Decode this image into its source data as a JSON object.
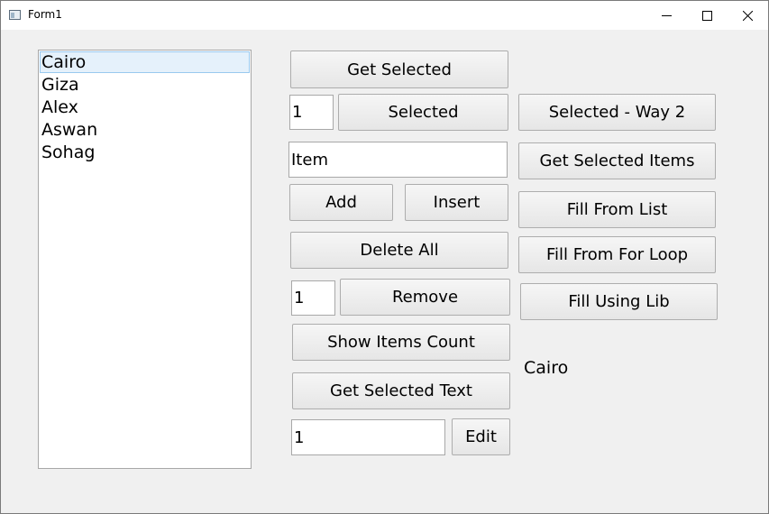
{
  "window": {
    "title": "Form1"
  },
  "listbox": {
    "items": [
      "Cairo",
      "Giza",
      "Alex",
      "Aswan",
      "Sohag"
    ],
    "selected": "Cairo"
  },
  "controls": {
    "get_selected_label": "Get Selected",
    "selected_index_value": "1",
    "selected_label": "Selected",
    "selected_way2_label": "Selected - Way 2",
    "item_input_value": "Item",
    "get_selected_items_label": "Get Selected Items",
    "add_label": "Add",
    "insert_label": "Insert",
    "fill_from_list_label": "Fill From List",
    "delete_all_label": "Delete All",
    "fill_from_for_loop_label": "Fill From For Loop",
    "remove_index_value": "1",
    "remove_label": "Remove",
    "fill_using_lib_label": "Fill Using Lib",
    "show_items_count_label": "Show Items Count",
    "result_label": "Cairo",
    "get_selected_text_label": "Get Selected Text",
    "edit_index_value": "1",
    "edit_label": "Edit"
  }
}
